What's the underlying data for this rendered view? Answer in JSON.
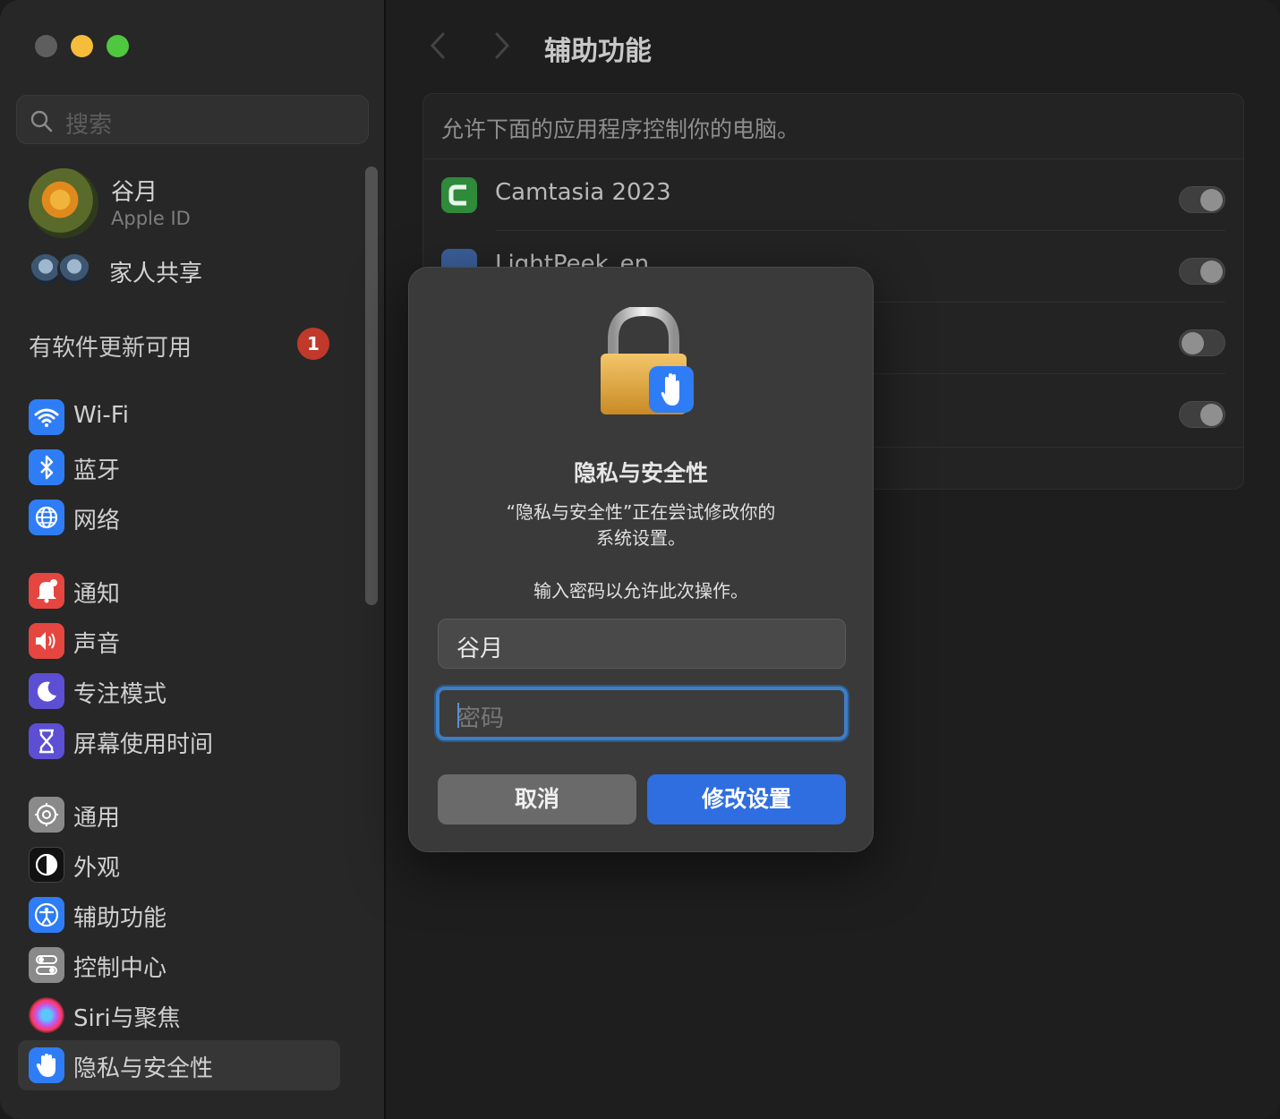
{
  "sidebar": {
    "search_placeholder": "搜索",
    "account": {
      "name": "谷月",
      "subtitle": "Apple ID"
    },
    "family_label": "家人共享",
    "update_label": "有软件更新可用",
    "update_count": "1",
    "items": [
      {
        "label": "Wi-Fi",
        "icon": "wifi-icon",
        "color": "#2f7df6"
      },
      {
        "label": "蓝牙",
        "icon": "bluetooth-icon",
        "color": "#2f7df6"
      },
      {
        "label": "网络",
        "icon": "globe-icon",
        "color": "#2f7df6"
      },
      {
        "label": "通知",
        "icon": "bell-icon",
        "color": "#e5463f"
      },
      {
        "label": "声音",
        "icon": "speaker-icon",
        "color": "#e5463f"
      },
      {
        "label": "专注模式",
        "icon": "moon-icon",
        "color": "#5c4fd3"
      },
      {
        "label": "屏幕使用时间",
        "icon": "hourglass-icon",
        "color": "#5c4fd3"
      },
      {
        "label": "通用",
        "icon": "gear-icon",
        "color": "#8a8a8a"
      },
      {
        "label": "外观",
        "icon": "appearance-icon",
        "color": "#1a1a1a"
      },
      {
        "label": "辅助功能",
        "icon": "accessibility-icon",
        "color": "#2f7df6"
      },
      {
        "label": "控制中心",
        "icon": "control-center-icon",
        "color": "#8a8a8a"
      },
      {
        "label": "Siri与聚焦",
        "icon": "siri-icon",
        "color": "#444"
      },
      {
        "label": "隐私与安全性",
        "icon": "hand-icon",
        "color": "#2f7df6"
      }
    ],
    "selected_index": 12
  },
  "main": {
    "title": "辅助功能",
    "description": "允许下面的应用程序控制你的电脑。",
    "apps": [
      {
        "name": "Camtasia 2023",
        "enabled": true
      },
      {
        "name": "LightPeek_en",
        "enabled": true
      },
      {
        "name": "",
        "enabled": false
      },
      {
        "name": "",
        "enabled": true
      }
    ]
  },
  "dialog": {
    "title": "隐私与安全性",
    "message_line1": "“隐私与安全性”正在尝试修改你的",
    "message_line2": "系统设置。",
    "prompt": "输入密码以允许此次操作。",
    "username": "谷月",
    "password_placeholder": "密码",
    "cancel_label": "取消",
    "confirm_label": "修改设置",
    "accent_color": "#2f6ee0"
  }
}
